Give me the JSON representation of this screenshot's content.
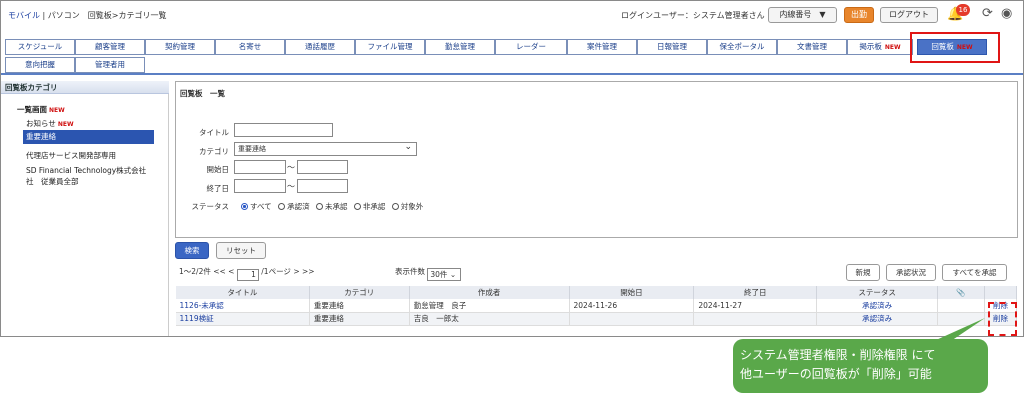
{
  "header": {
    "breadcrumb_mobile": "モバイル",
    "breadcrumb_rest": "| パソコン　回覧板>カテゴリ一覧",
    "login_user": "ログインユーザー：システム管理者さん",
    "extension_label": "内線番号　▼",
    "clockout_label": "出勤",
    "logout_label": "ログアウト",
    "notification_count": "16"
  },
  "tabs": [
    {
      "label": "スケジュール"
    },
    {
      "label": "顧客管理"
    },
    {
      "label": "契約管理"
    },
    {
      "label": "名寄せ"
    },
    {
      "label": "通話履歴"
    },
    {
      "label": "ファイル管理"
    },
    {
      "label": "勤怠管理"
    },
    {
      "label": "レーダー"
    },
    {
      "label": "案件管理"
    },
    {
      "label": "日報管理"
    },
    {
      "label": "保全ポータル"
    },
    {
      "label": "文書管理"
    },
    {
      "label": "掲示板",
      "badge": "NEW"
    },
    {
      "label": "回覧板",
      "badge": "NEW"
    },
    {
      "label": "意向把握"
    },
    {
      "label": "管理者用"
    }
  ],
  "sidebar": {
    "title": "回覧板カテゴリ",
    "items": [
      {
        "label": "一覧画面",
        "badge": "NEW"
      },
      {
        "label": "お知らせ",
        "badge": "NEW"
      },
      {
        "label": "重要連絡"
      },
      {
        "label": "代理店サービス開発部専用"
      },
      {
        "label": "SD Financial Technology株式会社"
      },
      {
        "label": "社　従業員全部"
      }
    ]
  },
  "panel": {
    "title": "回覧板　一覧",
    "labels": {
      "title": "タイトル",
      "category": "カテゴリ",
      "start": "開始日",
      "end": "終了日",
      "status": "ステータス"
    },
    "category_value": "重要連絡",
    "tilde": "～",
    "statuses": [
      {
        "label": "すべて",
        "checked": true
      },
      {
        "label": "承認済",
        "checked": false
      },
      {
        "label": "未承認",
        "checked": false
      },
      {
        "label": "非承認",
        "checked": false
      },
      {
        "label": "対象外",
        "checked": false
      }
    ]
  },
  "actions": {
    "search": "検索",
    "reset": "リセット",
    "new": "新規",
    "approval_status": "承認状況",
    "approve_all": "すべてを承認"
  },
  "pager": {
    "summary": "1～2/2件",
    "prev": "<< <",
    "page": "1",
    "total": "/1ページ",
    "next": "> >>",
    "per_label": "表示件数",
    "per_value": "30件"
  },
  "table": {
    "headers": [
      "タイトル",
      "カテゴリ",
      "作成者",
      "開始日",
      "終了日",
      "ステータス",
      "📎",
      ""
    ],
    "rows": [
      {
        "title": "1126-未承認",
        "category": "重要連絡",
        "author": "勤怠管理　良子",
        "start": "2024-11-26",
        "end": "2024-11-27",
        "status": "承認済み",
        "action": "削除"
      },
      {
        "title": "1119検証",
        "category": "重要連絡",
        "author": "吉良　一郎太",
        "start": "",
        "end": "",
        "status": "承認済み",
        "action": "削除"
      }
    ]
  },
  "callout": {
    "line1": "システム管理者権限・削除権限 にて",
    "line2": "他ユーザーの回覧板が「削除」可能"
  }
}
